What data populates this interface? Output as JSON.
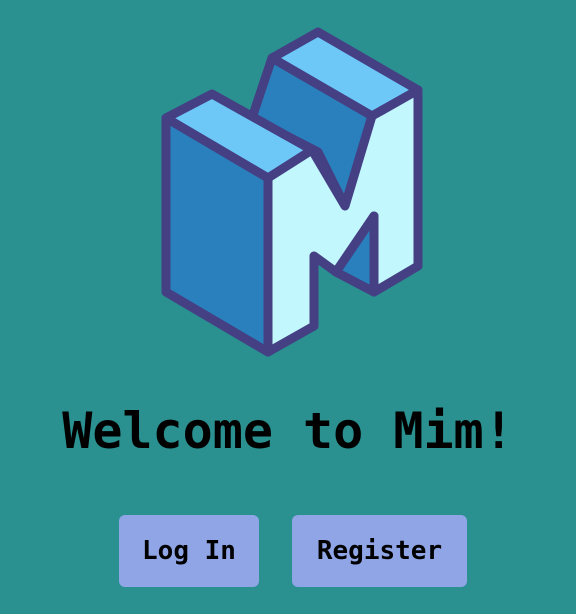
{
  "app": {
    "logo_icon": "block-letter-m-logo-icon",
    "title": "Welcome to Mim!"
  },
  "actions": {
    "login_label": "Log In",
    "register_label": "Register"
  },
  "colors": {
    "background": "#2a9090",
    "button_bg": "#8fa5e6",
    "logo_outline": "#453f84",
    "logo_top": "#6dc8f7",
    "logo_side": "#2a80bc",
    "logo_front": "#c2f7fd"
  }
}
